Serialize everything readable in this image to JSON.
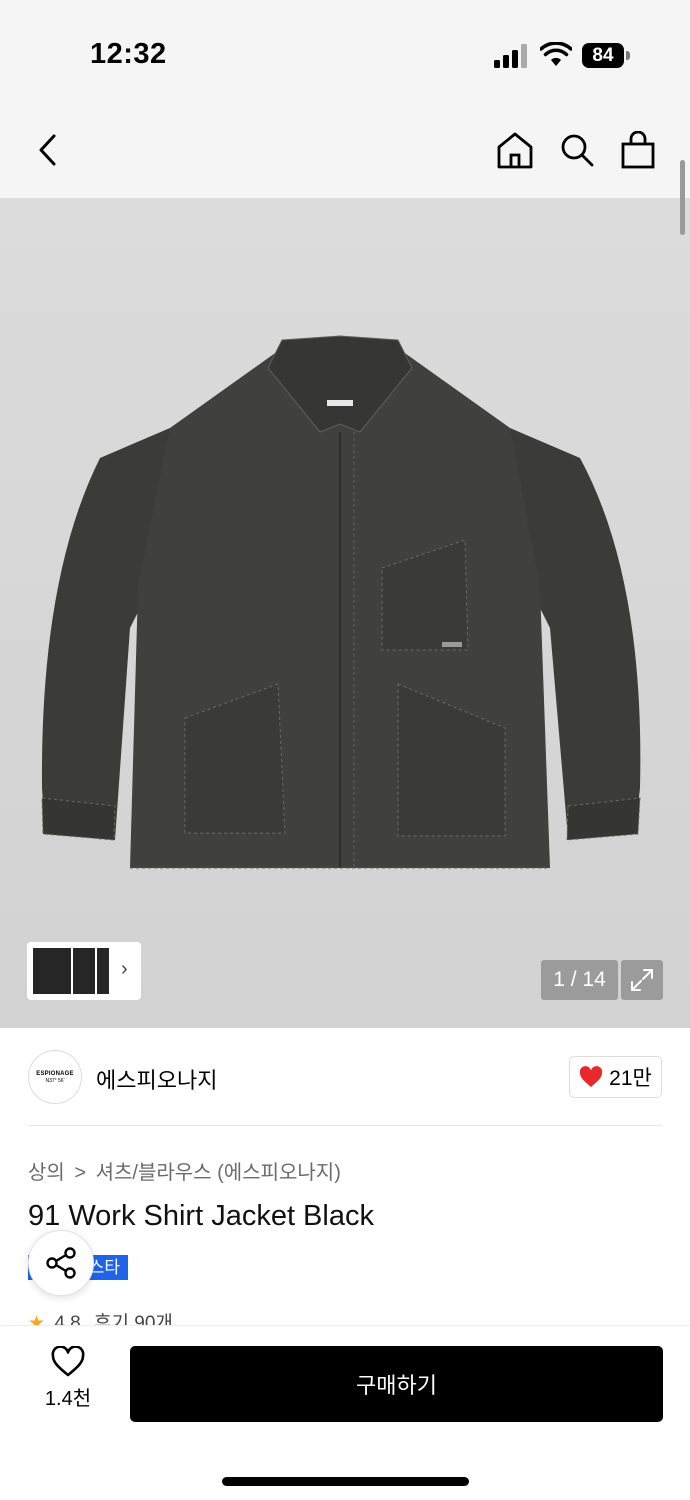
{
  "status": {
    "time": "12:32",
    "battery": "84"
  },
  "nav": {
    "back_icon": "chevron-left-icon",
    "home_icon": "home-icon",
    "search_icon": "search-icon",
    "cart_icon": "shopping-bag-icon"
  },
  "gallery": {
    "counter": "1 / 14",
    "thumb_more_icon": "chevron-right-icon",
    "expand_icon": "expand-icon",
    "bg": "#d7d7d7"
  },
  "brand": {
    "logo_text": "ESPIONAGE",
    "logo_sub": "N37° 56'",
    "name": "에스피오나지",
    "likes": "21만",
    "heart_color": "#e8282b"
  },
  "breadcrumb": {
    "level1": "상의",
    "separator": ">",
    "level2": "셔츠/블라우스 (에스피오나지)"
  },
  "product": {
    "title": "91 Work Shirt Jacket Black",
    "badge": "스타",
    "badge_color": "#1e63e8",
    "rating": "4.8",
    "reviews": "후기 90개"
  },
  "bottom": {
    "wish_count": "1.4천",
    "buy_label": "구매하기"
  }
}
